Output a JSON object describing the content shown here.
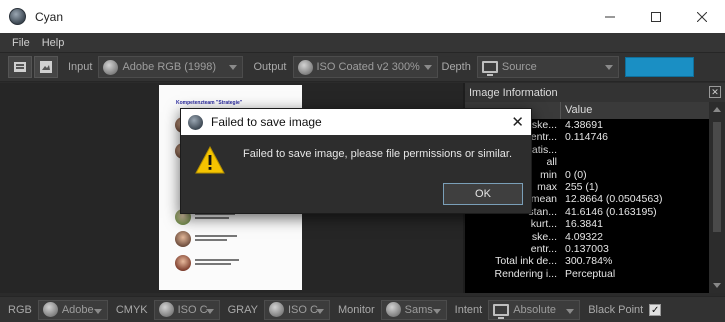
{
  "window": {
    "title": "Cyan",
    "minimize_icon": "minimize-icon",
    "maximize_icon": "maximize-icon",
    "close_icon": "close-icon"
  },
  "menu": {
    "items": [
      "File",
      "Help"
    ]
  },
  "toolbar": {
    "input_label": "Input",
    "input_profile": "Adobe RGB (1998)",
    "output_label": "Output",
    "output_profile": "ISO Coated v2 300%",
    "depth_label": "Depth",
    "depth_value": "Source",
    "accent_color": "#1a8fc4"
  },
  "panel": {
    "title": "Image Information",
    "columns": [
      "",
      "Value"
    ],
    "rows": [
      {
        "k": "ske...",
        "v": "4.38691"
      },
      {
        "k": "entr...",
        "v": "0.114746"
      },
      {
        "k": "statis...",
        "v": ""
      },
      {
        "k": "all",
        "v": ""
      },
      {
        "k": "min",
        "v": "0  (0)"
      },
      {
        "k": "max",
        "v": "255 (1)"
      },
      {
        "k": "mean",
        "v": "12.8664 (0.0504563)"
      },
      {
        "k": "stan...",
        "v": "41.6146 (0.163195)"
      },
      {
        "k": "kurt...",
        "v": "16.3841"
      },
      {
        "k": "ske...",
        "v": "4.09322"
      },
      {
        "k": "entr...",
        "v": "0.137003"
      },
      {
        "k": "Total ink de...",
        "v": "300.784%"
      },
      {
        "k": "Rendering i...",
        "v": "Perceptual"
      }
    ]
  },
  "statusbar": {
    "rgb_label": "RGB",
    "rgb_value": "Adobe",
    "cmyk_label": "CMYK",
    "cmyk_value": "ISO C",
    "gray_label": "GRAY",
    "gray_value": "ISO C",
    "monitor_label": "Monitor",
    "monitor_value": "Sams",
    "intent_label": "Intent",
    "intent_value": "Absolute",
    "blackpoint_label": "Black Point",
    "blackpoint_checked": "✓"
  },
  "dialog": {
    "title": "Failed to save image",
    "message": "Failed to save image, please file permissions or similar.",
    "ok_label": "OK",
    "icon": "warning-icon"
  }
}
